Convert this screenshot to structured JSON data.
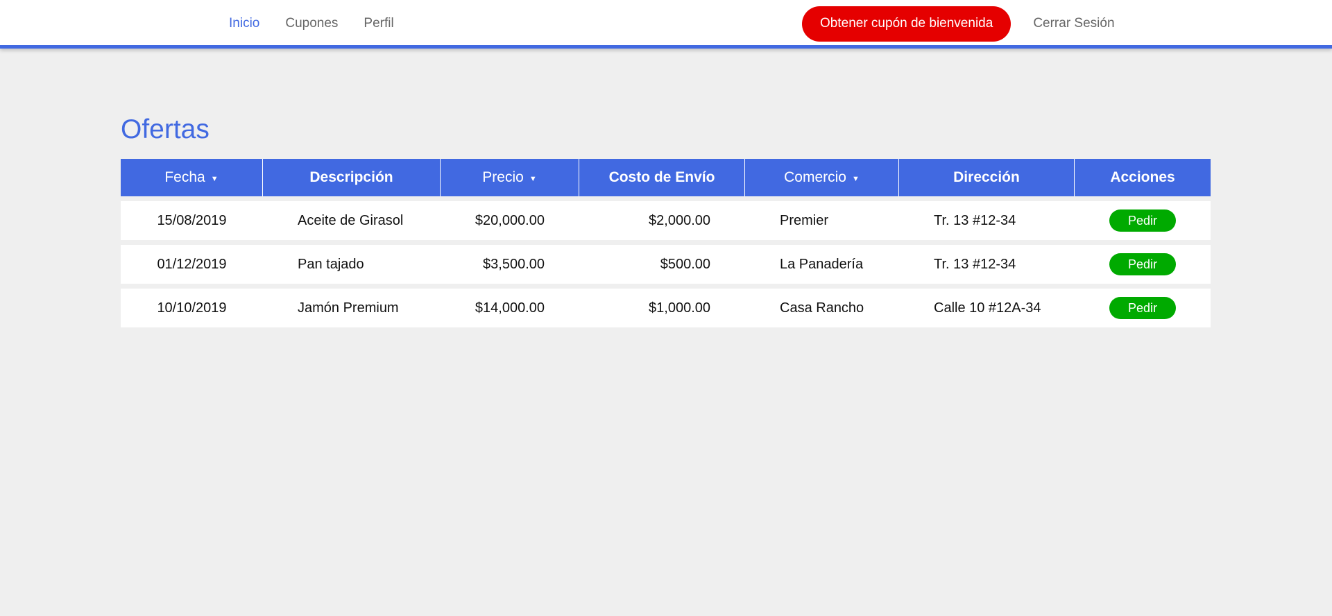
{
  "nav": {
    "links": [
      {
        "label": "Inicio",
        "active": true
      },
      {
        "label": "Cupones",
        "active": false
      },
      {
        "label": "Perfil",
        "active": false
      }
    ],
    "welcome_button": "Obtener cupón de bienvenida",
    "logout": "Cerrar Sesión"
  },
  "page": {
    "title": "Ofertas"
  },
  "table": {
    "headers": [
      {
        "label": "Fecha",
        "sortable": true
      },
      {
        "label": "Descripción",
        "sortable": false
      },
      {
        "label": "Precio",
        "sortable": true
      },
      {
        "label": "Costo de Envío",
        "sortable": false
      },
      {
        "label": "Comercio",
        "sortable": true
      },
      {
        "label": "Dirección",
        "sortable": false
      },
      {
        "label": "Acciones",
        "sortable": false
      }
    ],
    "sort_icon": "caret-down-icon",
    "rows": [
      {
        "date": "15/08/2019",
        "description": "Aceite de Girasol",
        "price": "$20,000.00",
        "shipping": "$2,000.00",
        "store": "Premier",
        "address": "Tr. 13 #12-34",
        "action": "Pedir"
      },
      {
        "date": "01/12/2019",
        "description": "Pan tajado",
        "price": "$3,500.00",
        "shipping": "$500.00",
        "store": "La Panadería",
        "address": "Tr. 13 #12-34",
        "action": "Pedir"
      },
      {
        "date": "10/10/2019",
        "description": "Jamón Premium",
        "price": "$14,000.00",
        "shipping": "$1,000.00",
        "store": "Casa Rancho",
        "address": "Calle 10 #12A-34",
        "action": "Pedir"
      }
    ]
  },
  "colors": {
    "accent": "#4169e1",
    "welcome_button": "#e50000",
    "order_button": "#00aa00",
    "background": "#efefef"
  }
}
